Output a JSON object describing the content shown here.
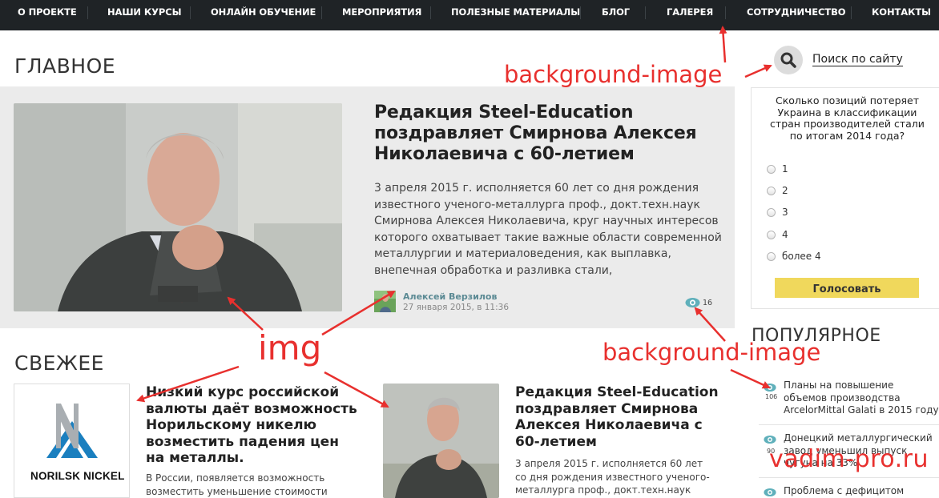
{
  "nav": {
    "items": [
      "О ПРОЕКТЕ",
      "НАШИ КУРСЫ",
      "ОНЛАЙН ОБУЧЕНИЕ",
      "МЕРОПРИЯТИЯ",
      "ПОЛЕЗНЫЕ МАТЕРИАЛЫ",
      "БЛОГ",
      "ГАЛЕРЕЯ",
      "СОТРУДНИЧЕСТВО",
      "КОНТАКТЫ"
    ]
  },
  "main": {
    "heading": "ГЛАВНОЕ",
    "featured": {
      "title": "Редакция Steel-Education поздравляет Смирнова Алексея Николаевича с 60-летием",
      "text": "3 апреля 2015 г. исполняется 60 лет со дня рождения известного ученого-металлурга проф., докт.техн.наук Смирнова Алексея Николаевича, круг научных интересов которого охватывает такие важные области современной металлургии и материаловедения, как выплавка, внепечная обработка и разливка стали,",
      "author": "Алексей Верзилов",
      "date": "27 января 2015, в 11:36",
      "views": "16"
    }
  },
  "fresh": {
    "heading": "СВЕЖЕЕ",
    "articles": [
      {
        "title": "Низкий курс российской валюты даёт возможность Норильскому никелю возместить падения цен на металлы.",
        "text": "В России, появляется возможность возместить уменьшение стоимости",
        "logo_text": "NORILSK NICKEL"
      },
      {
        "title": "Редакция Steel-Education поздравляет Смирнова Алексея Николаевича с 60-летием",
        "text": "3 апреля 2015 г. исполняется 60 лет со дня рождения известного ученого-металлурга проф., докт.техн.наук"
      }
    ]
  },
  "sidebar": {
    "search_label": "Поиск по сайту",
    "poll": {
      "question": "Сколько позиций потеряет Украина в классификации стран производителей стали по итогам 2014 года?",
      "options": [
        "1",
        "2",
        "3",
        "4",
        "более 4"
      ],
      "vote_label": "Голосовать"
    },
    "popular": {
      "heading": "ПОПУЛЯРНОЕ",
      "items": [
        {
          "text": "Планы на повышение объемов производства ArcelorMittal Galati в 2015 году",
          "views": "106"
        },
        {
          "text": "Донецкий металлургический завод уменьшил выпуск чугуна на 33%",
          "views": "90"
        },
        {
          "text": "Проблема с дефицитом",
          "views": ""
        }
      ]
    }
  },
  "annotations": {
    "labels": [
      "background-image",
      "img",
      "background-image"
    ],
    "watermark": "vadim-pro.ru"
  },
  "colors": {
    "nav_bg": "#1f2326",
    "hero_bg": "#ebebeb",
    "vote_button": "#f0d85c",
    "accent_teal": "#5fb0bb",
    "annotation_red": "#e8302e"
  }
}
